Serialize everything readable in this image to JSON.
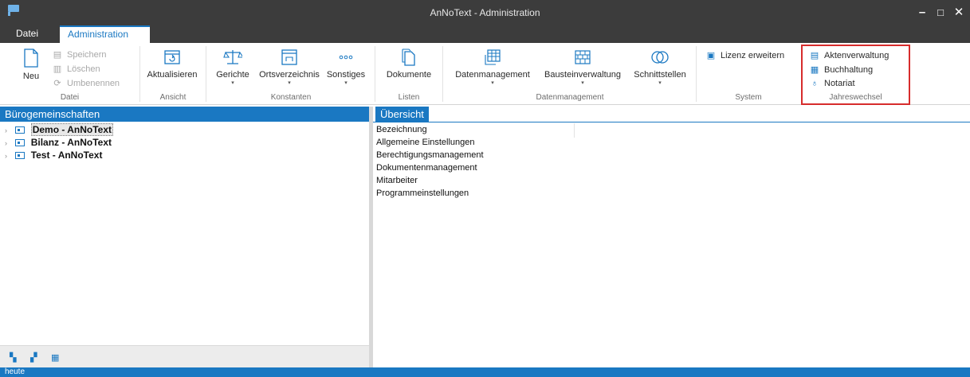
{
  "window": {
    "title": "AnNoText - Administration",
    "controls": {
      "minimize": "–",
      "maximize": "□",
      "close": "✕"
    }
  },
  "menu": {
    "tabs": [
      {
        "label": "Datei"
      },
      {
        "label": "Administration",
        "active": true
      }
    ]
  },
  "ribbon": {
    "groups": {
      "datei": {
        "label": "Datei",
        "new_label": "Neu",
        "save_label": "Speichern",
        "delete_label": "Löschen",
        "rename_label": "Umbenennen"
      },
      "ansicht": {
        "label": "Ansicht",
        "refresh_label": "Aktualisieren"
      },
      "konstanten": {
        "label": "Konstanten",
        "courts_label": "Gerichte",
        "places_label": "Ortsverzeichnis",
        "other_label": "Sonstiges"
      },
      "listen": {
        "label": "Listen",
        "documents_label": "Dokumente"
      },
      "datenmanagement": {
        "label": "Datenmanagement",
        "data_label": "Datenmanagement",
        "modules_label": "Bausteinverwaltung",
        "interfaces_label": "Schnittstellen"
      },
      "system": {
        "label": "System",
        "license_label": "Lizenz erweitern"
      },
      "jahreswechsel": {
        "label": "Jahreswechsel",
        "files_label": "Aktenverwaltung",
        "accounting_label": "Buchhaltung",
        "notary_label": "Notariat"
      }
    },
    "highlight_color": "#d72c2c"
  },
  "left_pane": {
    "title": "Bürogemeinschaften",
    "items": [
      {
        "label": "Demo - AnNoText",
        "selected": true
      },
      {
        "label": "Bilanz - AnNoText"
      },
      {
        "label": "Test - AnNoText"
      }
    ]
  },
  "right_pane": {
    "tab_label": "Übersicht",
    "items": [
      "Bezeichnung",
      "Allgemeine Einstellungen",
      "Berechtigungsmanagement",
      "Dokumentenmanagement",
      "Mitarbeiter",
      "Programmeinstellungen"
    ]
  },
  "statusbar": {
    "text": "heute"
  },
  "colors": {
    "accent": "#1a78c2",
    "titlebar": "#3c3c3c"
  }
}
